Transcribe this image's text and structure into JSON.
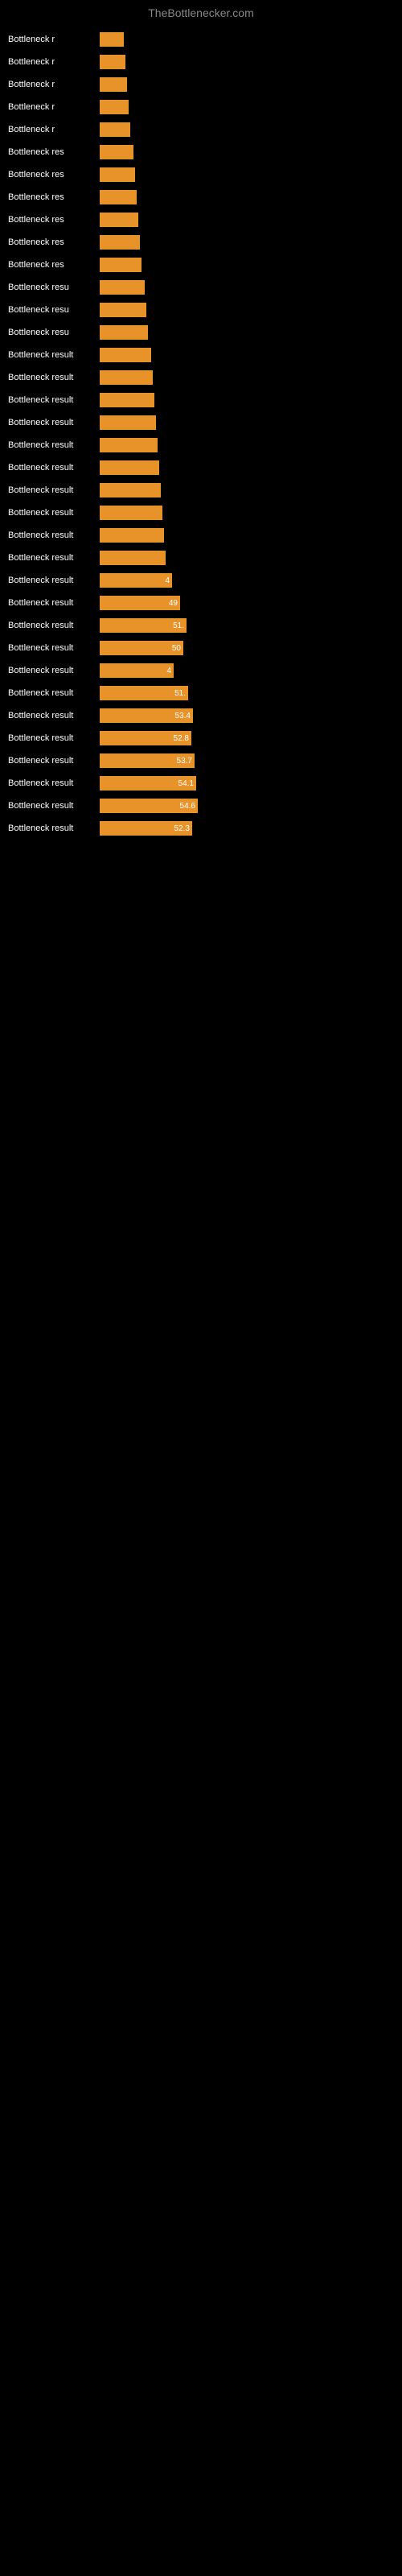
{
  "site_title": "TheBottlenecker.com",
  "rows": [
    {
      "label": "Bottleneck r",
      "width": 30,
      "value": ""
    },
    {
      "label": "Bottleneck r",
      "width": 32,
      "value": ""
    },
    {
      "label": "Bottleneck r",
      "width": 34,
      "value": ""
    },
    {
      "label": "Bottleneck r",
      "width": 36,
      "value": ""
    },
    {
      "label": "Bottleneck r",
      "width": 38,
      "value": ""
    },
    {
      "label": "Bottleneck res",
      "width": 42,
      "value": ""
    },
    {
      "label": "Bottleneck res",
      "width": 44,
      "value": ""
    },
    {
      "label": "Bottleneck res",
      "width": 46,
      "value": ""
    },
    {
      "label": "Bottleneck res",
      "width": 48,
      "value": ""
    },
    {
      "label": "Bottleneck res",
      "width": 50,
      "value": ""
    },
    {
      "label": "Bottleneck res",
      "width": 52,
      "value": ""
    },
    {
      "label": "Bottleneck resu",
      "width": 56,
      "value": ""
    },
    {
      "label": "Bottleneck resu",
      "width": 58,
      "value": ""
    },
    {
      "label": "Bottleneck resu",
      "width": 60,
      "value": ""
    },
    {
      "label": "Bottleneck result",
      "width": 64,
      "value": ""
    },
    {
      "label": "Bottleneck result",
      "width": 66,
      "value": ""
    },
    {
      "label": "Bottleneck result",
      "width": 68,
      "value": ""
    },
    {
      "label": "Bottleneck result",
      "width": 70,
      "value": ""
    },
    {
      "label": "Bottleneck result",
      "width": 72,
      "value": ""
    },
    {
      "label": "Bottleneck result",
      "width": 74,
      "value": ""
    },
    {
      "label": "Bottleneck result",
      "width": 76,
      "value": ""
    },
    {
      "label": "Bottleneck result",
      "width": 78,
      "value": ""
    },
    {
      "label": "Bottleneck result",
      "width": 80,
      "value": ""
    },
    {
      "label": "Bottleneck result",
      "width": 82,
      "value": ""
    },
    {
      "label": "Bottleneck result",
      "width": 90,
      "value": "4"
    },
    {
      "label": "Bottleneck result",
      "width": 100,
      "value": "49"
    },
    {
      "label": "Bottleneck result",
      "width": 108,
      "value": "51."
    },
    {
      "label": "Bottleneck result",
      "width": 104,
      "value": "50"
    },
    {
      "label": "Bottleneck result",
      "width": 92,
      "value": "4"
    },
    {
      "label": "Bottleneck result",
      "width": 110,
      "value": "51."
    },
    {
      "label": "Bottleneck result",
      "width": 116,
      "value": "53.4"
    },
    {
      "label": "Bottleneck result",
      "width": 114,
      "value": "52.8"
    },
    {
      "label": "Bottleneck result",
      "width": 118,
      "value": "53.7"
    },
    {
      "label": "Bottleneck result",
      "width": 120,
      "value": "54.1"
    },
    {
      "label": "Bottleneck result",
      "width": 122,
      "value": "54.6"
    },
    {
      "label": "Bottleneck result",
      "width": 115,
      "value": "52.3"
    }
  ]
}
